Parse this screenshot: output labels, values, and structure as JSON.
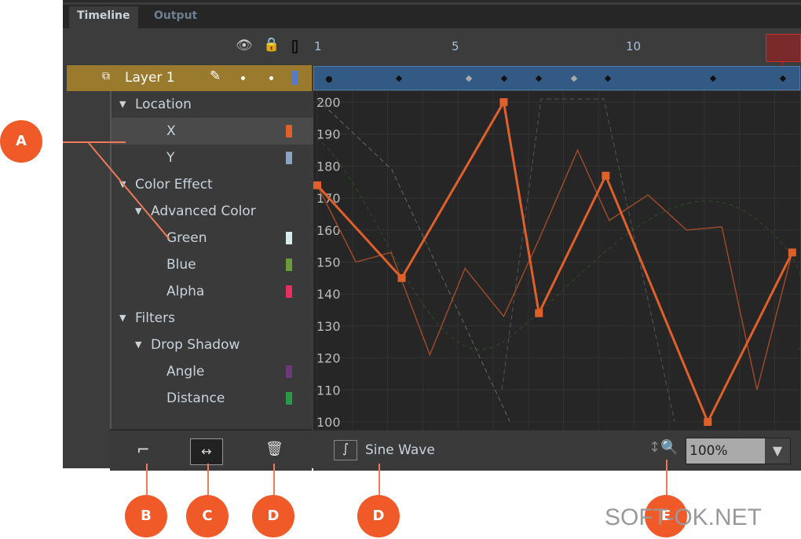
{
  "tabs": [
    {
      "label": "Timeline",
      "active": true
    },
    {
      "label": "Output"
    }
  ],
  "ruler": {
    "frames": [
      "1",
      "5",
      "10"
    ]
  },
  "header_icons": [
    "eye-icon",
    "lock-icon",
    "outline-icon"
  ],
  "layer": {
    "name": "Layer 1"
  },
  "properties": [
    {
      "label": "Location",
      "level": 0,
      "expanded": true
    },
    {
      "label": "X",
      "level": 2,
      "color": "#e0602a",
      "selected": true
    },
    {
      "label": "Y",
      "level": 2,
      "color": "#8aa4c0"
    },
    {
      "label": "Color Effect",
      "level": 0,
      "expanded": true
    },
    {
      "label": "Advanced Color",
      "level": 1,
      "expanded": true
    },
    {
      "label": "Green",
      "level": 2,
      "color": "#d8ecec"
    },
    {
      "label": "Blue",
      "level": 2,
      "color": "#6a9a3a"
    },
    {
      "label": "Alpha",
      "level": 2,
      "color": "#e83060"
    },
    {
      "label": "Filters",
      "level": 0,
      "expanded": true
    },
    {
      "label": "Drop Shadow",
      "level": 1,
      "expanded": true
    },
    {
      "label": "Angle",
      "level": 2,
      "color": "#6a3a7a"
    },
    {
      "label": "Distance",
      "level": 2,
      "color": "#2a9a4a"
    }
  ],
  "chart_data": {
    "type": "line",
    "ylim": [
      100,
      200
    ],
    "yticks": [
      "200",
      "190",
      "180",
      "170",
      "160",
      "150",
      "140",
      "130",
      "120",
      "110",
      "100"
    ],
    "series": [
      {
        "x": [
          1,
          3.4,
          6.3,
          7.3,
          9.2,
          12.1,
          14.5
        ],
        "values": [
          174,
          145,
          200,
          134,
          177,
          100,
          153
        ],
        "color": "#e0602a"
      },
      {
        "x": [
          1,
          2.1,
          3.1,
          4.2,
          5.2,
          6.3,
          7.3,
          8.4,
          9.3,
          10.4,
          11.5,
          12.5,
          13.5,
          14.5
        ],
        "values": [
          174,
          150,
          153,
          121,
          148,
          133,
          157,
          185,
          163,
          171,
          160,
          161,
          110,
          153
        ],
        "color": "#9a4a2a"
      }
    ]
  },
  "footer": {
    "preset": "Sine Wave",
    "zoom": "100%"
  },
  "callouts": [
    "A",
    "B",
    "C",
    "D",
    "D",
    "E"
  ],
  "watermark": "SOFT-OK.NET",
  "colors": {
    "layer": "#9a7a2c",
    "accent": "#f05a28"
  }
}
